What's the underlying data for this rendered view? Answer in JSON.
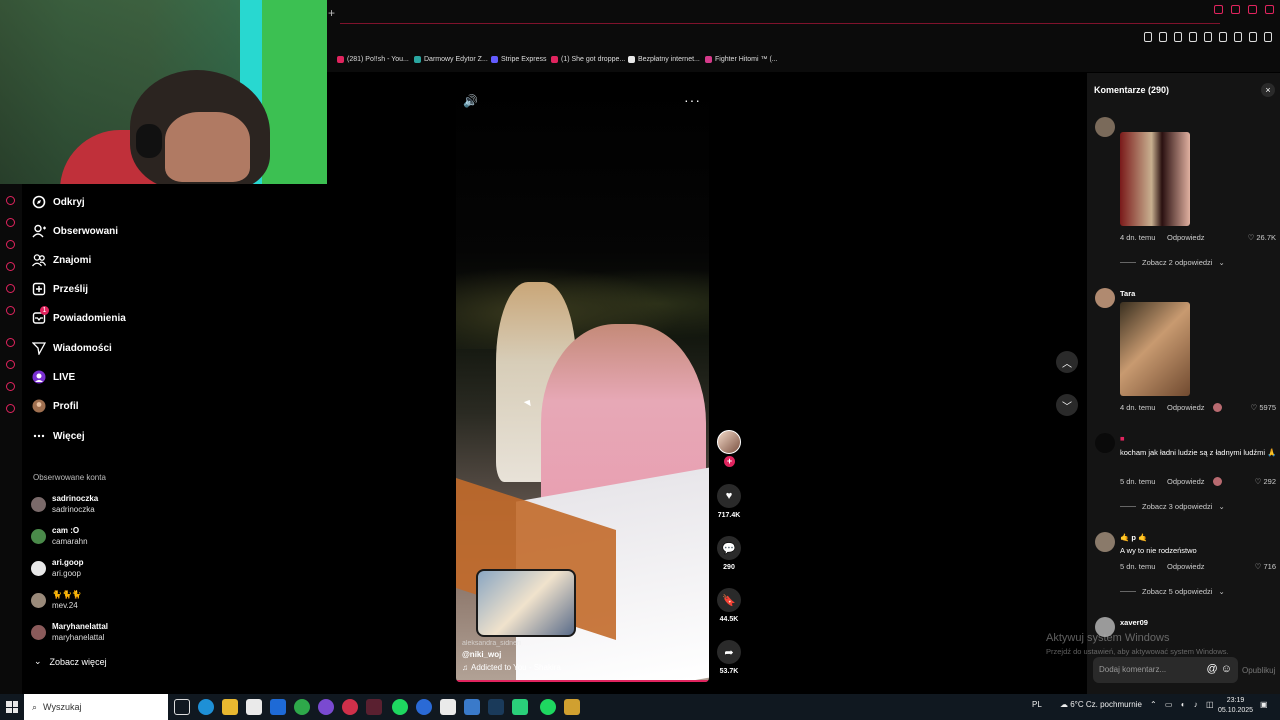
{
  "browser": {
    "new_tab": "+",
    "bookmarks": [
      {
        "label": "(281) Po!!sh - You...",
        "color": "#e0245e"
      },
      {
        "label": "Darmowy Edytor Z...",
        "color": "#2aa6a0"
      },
      {
        "label": "Stripe Express",
        "color": "#635bff"
      },
      {
        "label": "(1) She got droppe...",
        "color": "#e0245e"
      },
      {
        "label": "Bezpłatny internet...",
        "color": "#e8e8e8"
      },
      {
        "label": "Fighter Hitomi ™ (...",
        "color": "#d43a8a"
      }
    ]
  },
  "nav": {
    "items": [
      {
        "label": "Odkryj",
        "icon": "compass-icon"
      },
      {
        "label": "Obserwowani",
        "icon": "person-add-icon"
      },
      {
        "label": "Znajomi",
        "icon": "people-icon"
      },
      {
        "label": "Prześlij",
        "icon": "upload-icon"
      },
      {
        "label": "Powiadomienia",
        "icon": "inbox-icon",
        "badge": "1"
      },
      {
        "label": "Wiadomości",
        "icon": "send-icon"
      },
      {
        "label": "LIVE",
        "icon": "live-icon"
      },
      {
        "label": "Profil",
        "icon": "avatar-icon"
      },
      {
        "label": "Więcej",
        "icon": "more-icon"
      }
    ],
    "followed_heading": "Obserwowane konta",
    "accounts": [
      {
        "name": "sadrinoczka",
        "handle": "sadrinoczka"
      },
      {
        "name": "cam :O",
        "handle": "camarahn"
      },
      {
        "name": "ari.goop",
        "handle": "ari.goop"
      },
      {
        "name": "🐈🐈🐈",
        "handle": "mev.24"
      },
      {
        "name": "Maryhanelattal",
        "handle": "maryhanelattal"
      }
    ],
    "see_more": "Zobacz więcej"
  },
  "video": {
    "author_ghost": "aleksandra_sidneri",
    "author": "@niki_woj",
    "music": "Addicted to You - Shakira",
    "likes": "717.4K",
    "comments": "290",
    "saves": "44.5K",
    "shares": "53.7K",
    "follow_plus": "+"
  },
  "comments_panel": {
    "title": "Komentarze (290)",
    "close": "×",
    "reply_label": "Odpowiedz",
    "items": [
      {
        "user": "",
        "text": "",
        "time": "4 dn. temu",
        "likes": "26.7K",
        "more": "Zobacz 2 odpowiedzi"
      },
      {
        "user": "Tara",
        "text": "",
        "time": "4 dn. temu",
        "likes": "5975",
        "more": ""
      },
      {
        "user": "",
        "text": "kocham jak ładni ludzie są z ładnymi ludźmi 🙏",
        "time": "5 dn. temu",
        "likes": "292",
        "more": "Zobacz 3 odpowiedzi"
      },
      {
        "user": "🤙 p 🤙",
        "text": "A wy to nie rodzeństwo",
        "time": "5 dn. temu",
        "likes": "716",
        "more": "Zobacz 5 odpowiedzi"
      },
      {
        "user": "xaver09",
        "text": "",
        "time": "",
        "likes": "",
        "more": ""
      }
    ],
    "input_placeholder": "Dodaj komentarz...",
    "input_icons": "@ ☺",
    "publish": "Opublikuj"
  },
  "watermark": {
    "line1": "Aktywuj system Windows",
    "line2": "Przejdź do ustawień, aby aktywować system Windows."
  },
  "taskbar": {
    "search": "Wyszukaj",
    "lang": "PL",
    "weather": "6°C  Cz. pochmurnie",
    "time": "23:19",
    "date": "05.10.2025"
  }
}
